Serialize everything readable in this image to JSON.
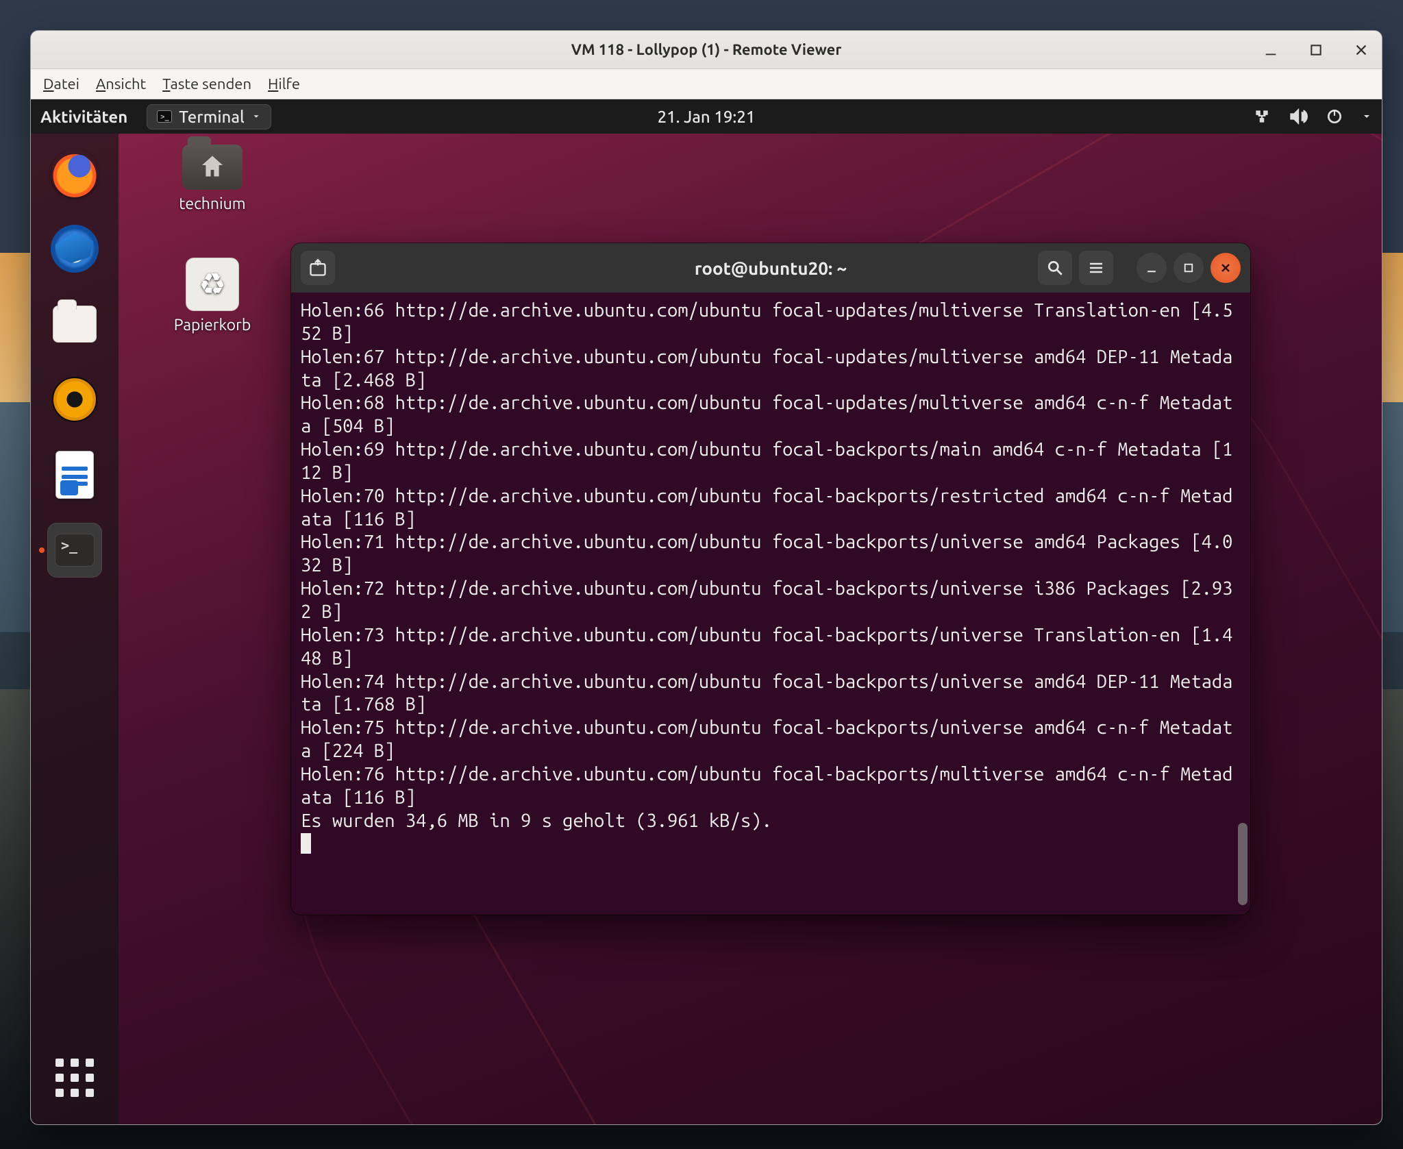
{
  "viewer": {
    "title": "VM 118 - Lollypop (1) - Remote Viewer",
    "menu": {
      "file": "Datei",
      "view": "Ansicht",
      "sendkey": "Taste senden",
      "help": "Hilfe"
    }
  },
  "gnome": {
    "activities": "Aktivitäten",
    "app_label": "Terminal",
    "clock": "21. Jan  19:21"
  },
  "desktop": {
    "home_label": "technium",
    "trash_label": "Papierkorb"
  },
  "dock": {
    "items": [
      {
        "name": "firefox"
      },
      {
        "name": "thunderbird"
      },
      {
        "name": "files"
      },
      {
        "name": "rhythmbox"
      },
      {
        "name": "libreoffice-writer"
      },
      {
        "name": "terminal",
        "active": true
      }
    ]
  },
  "terminal": {
    "title": "root@ubuntu20: ~",
    "lines": [
      "Holen:66 http://de.archive.ubuntu.com/ubuntu focal-updates/multiverse Translation-en [4.552 B]",
      "Holen:67 http://de.archive.ubuntu.com/ubuntu focal-updates/multiverse amd64 DEP-11 Metadata [2.468 B]",
      "Holen:68 http://de.archive.ubuntu.com/ubuntu focal-updates/multiverse amd64 c-n-f Metadata [504 B]",
      "Holen:69 http://de.archive.ubuntu.com/ubuntu focal-backports/main amd64 c-n-f Metadata [112 B]",
      "Holen:70 http://de.archive.ubuntu.com/ubuntu focal-backports/restricted amd64 c-n-f Metadata [116 B]",
      "Holen:71 http://de.archive.ubuntu.com/ubuntu focal-backports/universe amd64 Packages [4.032 B]",
      "Holen:72 http://de.archive.ubuntu.com/ubuntu focal-backports/universe i386 Packages [2.932 B]",
      "Holen:73 http://de.archive.ubuntu.com/ubuntu focal-backports/universe Translation-en [1.448 B]",
      "Holen:74 http://de.archive.ubuntu.com/ubuntu focal-backports/universe amd64 DEP-11 Metadata [1.768 B]",
      "Holen:75 http://de.archive.ubuntu.com/ubuntu focal-backports/universe amd64 c-n-f Metadata [224 B]",
      "Holen:76 http://de.archive.ubuntu.com/ubuntu focal-backports/multiverse amd64 c-n-f Metadata [116 B]",
      "Es wurden 34,6 MB in 9 s geholt (3.961 kB/s)."
    ]
  }
}
